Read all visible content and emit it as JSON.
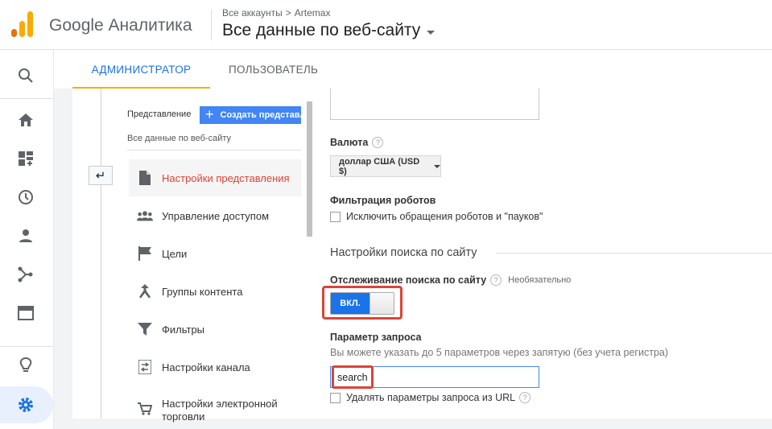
{
  "header": {
    "app_title": "Google Аналитика",
    "breadcrumb": {
      "root": "Все аккаунты",
      "separator": ">",
      "account": "Artemax"
    },
    "view_title": "Все данные по веб-сайту"
  },
  "rail": {
    "icons": [
      "search-icon",
      "home-icon",
      "customization-icon",
      "realtime-clock-icon",
      "audience-person-icon",
      "acquisition-icon",
      "behavior-icon",
      "discover-lightbulb-icon",
      "admin-gear-icon"
    ]
  },
  "tabs": [
    {
      "label": "АДМИНИСТРАТОР",
      "active": true
    },
    {
      "label": "ПОЛЬЗОВАТЕЛЬ",
      "active": false
    }
  ],
  "view_column": {
    "label": "Представление",
    "create_button": "Создать представл",
    "current_view": "Все данные по веб-сайту",
    "menu": [
      {
        "label": "Настройки представления",
        "icon": "document-icon",
        "active": true
      },
      {
        "label": "Управление доступом",
        "icon": "people-icon",
        "active": false
      },
      {
        "label": "Цели",
        "icon": "flag-icon",
        "active": false
      },
      {
        "label": "Группы контента",
        "icon": "merge-arrows-icon",
        "active": false
      },
      {
        "label": "Фильтры",
        "icon": "filter-icon",
        "active": false
      },
      {
        "label": "Настройки канала",
        "icon": "channel-icon",
        "active": false
      },
      {
        "label": "Настройки электронной торговли",
        "icon": "cart-icon",
        "active": false
      }
    ]
  },
  "settings": {
    "currency": {
      "label": "Валюта",
      "value": "доллар США (USD $)"
    },
    "bot_filtering": {
      "label": "Фильтрация роботов",
      "checkbox_label": "Исключить обращения роботов и \"пауков\"",
      "checked": false
    },
    "site_search_section": "Настройки поиска по сайту",
    "site_search_tracking": {
      "label": "Отслеживание поиска по сайту",
      "optional": "Необязательно",
      "toggle_label": "ВКЛ.",
      "on": true
    },
    "query_parameter": {
      "label": "Параметр запроса",
      "description": "Вы можете указать до 5 параметров через запятую (без учета регистра)",
      "value": "search",
      "strip_label": "Удалять параметры запроса из URL",
      "strip_checked": false
    }
  },
  "colors": {
    "accent_blue": "#1a73e8",
    "highlight_red": "#db4437",
    "tab_underline": "#f9ab00"
  }
}
